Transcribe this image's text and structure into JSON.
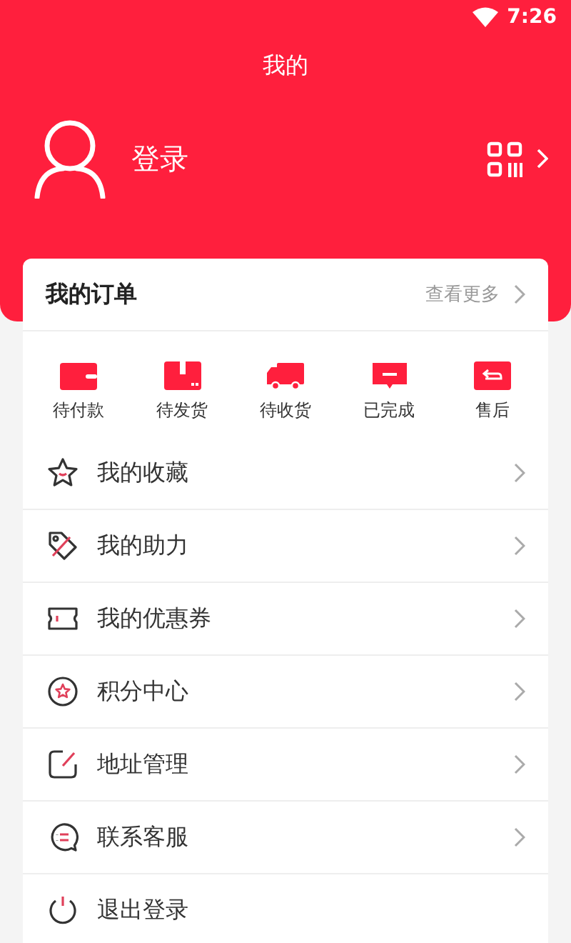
{
  "status_bar": {
    "time": "7:26"
  },
  "header": {
    "title": "我的",
    "login": "登录"
  },
  "orders": {
    "title": "我的订单",
    "more": "查看更多",
    "items": [
      {
        "label": "待付款"
      },
      {
        "label": "待发货"
      },
      {
        "label": "待收货"
      },
      {
        "label": "已完成"
      },
      {
        "label": "售后"
      }
    ]
  },
  "menu": [
    {
      "label": "我的收藏",
      "kind": "link"
    },
    {
      "label": "我的助力",
      "kind": "link"
    },
    {
      "label": "我的优惠券",
      "kind": "link"
    },
    {
      "label": "积分中心",
      "kind": "link"
    },
    {
      "label": "地址管理",
      "kind": "link"
    },
    {
      "label": "联系客服",
      "kind": "link"
    },
    {
      "label": "退出登录",
      "kind": "action"
    }
  ]
}
